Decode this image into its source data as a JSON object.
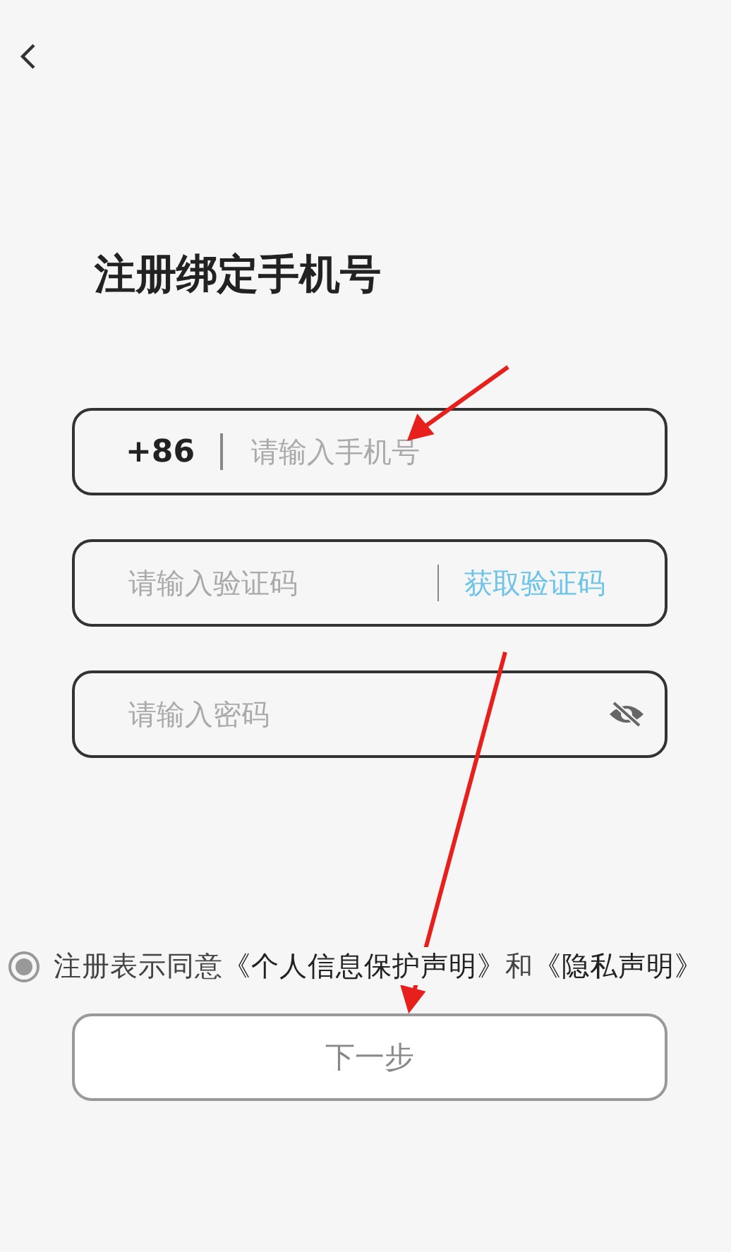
{
  "title": "注册绑定手机号",
  "phone": {
    "country_code": "+86",
    "placeholder": "请输入手机号"
  },
  "code": {
    "placeholder": "请输入验证码",
    "action": "获取验证码"
  },
  "password": {
    "placeholder": "请输入密码"
  },
  "agreement": {
    "checked": true,
    "parts": [
      {
        "kind": "text",
        "text": "注册表示同意"
      },
      {
        "kind": "link",
        "text": "《个人信息保护声明》"
      },
      {
        "kind": "text",
        "text": "和"
      },
      {
        "kind": "link",
        "text": "《隐私声明》"
      }
    ]
  },
  "next_button": "下一步"
}
